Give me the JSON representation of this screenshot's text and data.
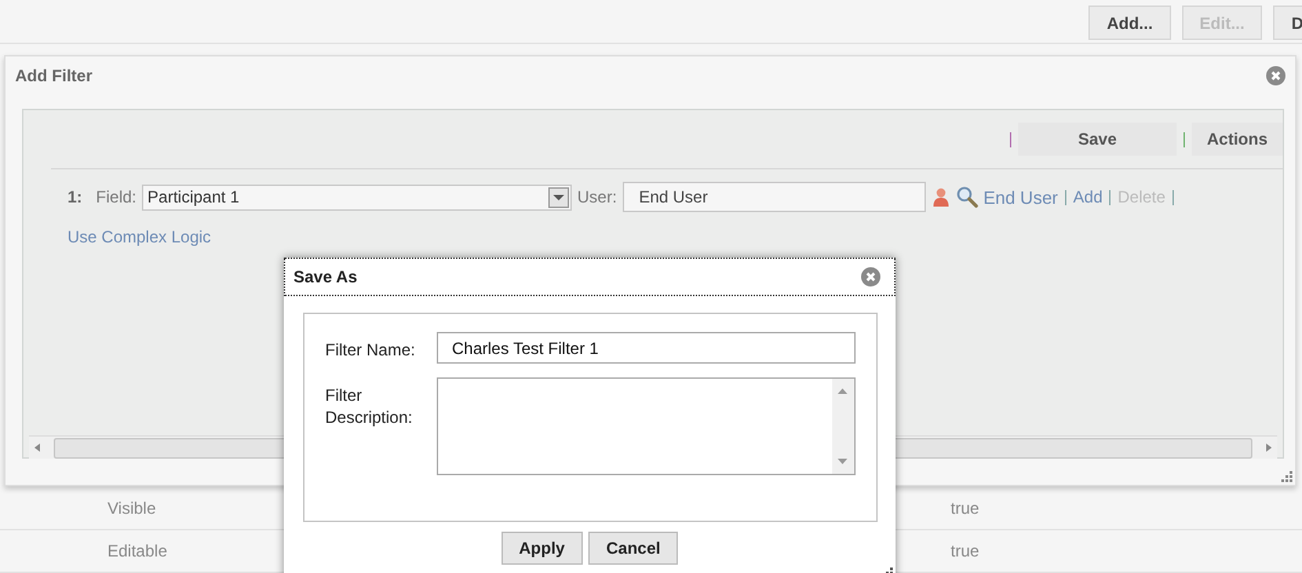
{
  "toolbar": {
    "buttons": [
      {
        "label": "Add...",
        "disabled": false
      },
      {
        "label": "Edit...",
        "disabled": true
      },
      {
        "label": "D",
        "disabled": false
      }
    ]
  },
  "table": {
    "rows": [
      {
        "cells": [
          "Visible",
          "true"
        ]
      },
      {
        "cells": [
          "Editable",
          "true"
        ]
      }
    ]
  },
  "add_filter": {
    "title": "Add Filter",
    "toolbar": [
      "Save",
      "Actions"
    ],
    "condition": {
      "number": "1:",
      "field_label": "Field:",
      "field_value": "Participant 1",
      "user_label": "User:",
      "user_value": "End User",
      "user_link": "End User",
      "links": [
        {
          "label": "Add",
          "disabled": false
        },
        {
          "label": "Delete",
          "disabled": true
        }
      ]
    },
    "complex_logic_link": "Use Complex Logic"
  },
  "save_as": {
    "title": "Save As",
    "name_label": "Filter Name:",
    "name_value": "Charles Test Filter 1",
    "description_label": "Filter Description:",
    "buttons": [
      "Apply",
      "Cancel"
    ]
  }
}
